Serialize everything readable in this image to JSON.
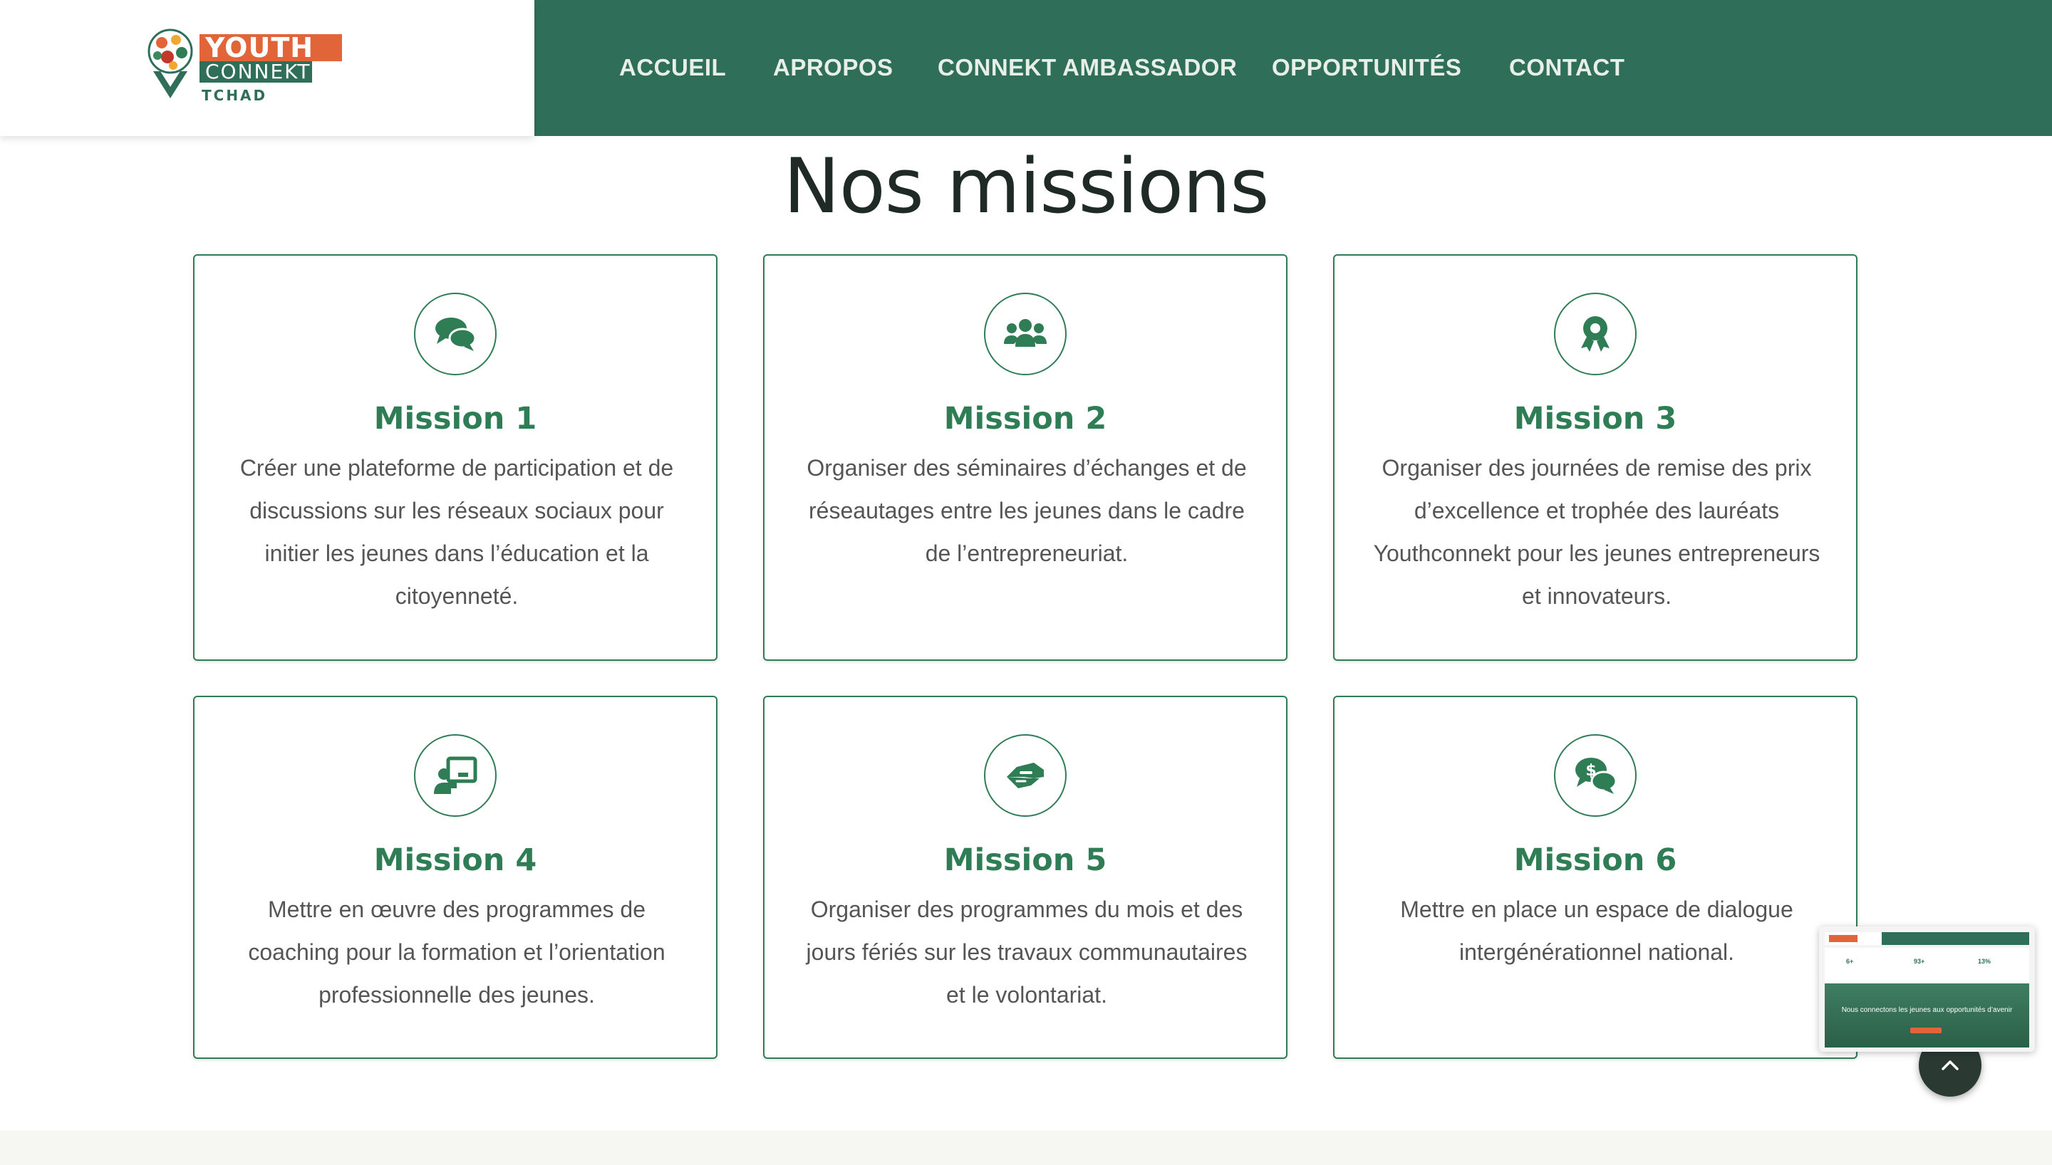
{
  "header": {
    "logo": {
      "line1": "YOUTH",
      "line2": "CONNEKT",
      "line3": "TCHAD"
    },
    "nav": [
      {
        "label": "ACCUEIL"
      },
      {
        "label": "APROPOS"
      },
      {
        "label": "CONNEKT AMBASSADOR"
      },
      {
        "label": "OPPORTUNITÉS"
      },
      {
        "label": "CONTACT"
      }
    ]
  },
  "section": {
    "title": "Nos missions"
  },
  "missions": [
    {
      "title": "Mission 1",
      "icon": "comments-icon",
      "text": "Créer une plateforme de participation et de discussions sur les réseaux sociaux pour initier les jeunes dans l’éducation et la citoyenneté."
    },
    {
      "title": "Mission 2",
      "icon": "users-icon",
      "text": "Organiser des séminaires d’échanges et de réseautages entre les jeunes dans le cadre de l’entrepreneuriat."
    },
    {
      "title": "Mission 3",
      "icon": "award-icon",
      "text": "Organiser des journées de remise des prix d’excellence et trophée des lauréats Youthconnekt pour les jeunes entrepreneurs et innovateurs."
    },
    {
      "title": "Mission 4",
      "icon": "chalkboard-teacher-icon",
      "text": "Mettre en œuvre des programmes de coaching pour la formation et l’orientation professionnelle des jeunes."
    },
    {
      "title": "Mission 5",
      "icon": "handshake-icon",
      "text": "Organiser des programmes du mois et des jours fériés sur les travaux communautaires et le volontariat."
    },
    {
      "title": "Mission 6",
      "icon": "comments-dollar-icon",
      "text": "Mettre en place un espace de dialogue intergénérationnel national."
    }
  ],
  "preview": {
    "stats": [
      "6+",
      "93+",
      "13%"
    ],
    "hero_text": "Nous connectons les jeunes aux opportunités d’avenir"
  },
  "colors": {
    "primary": "#2f6f5a",
    "accent": "#e2653a",
    "card_border": "#2f7d55"
  }
}
